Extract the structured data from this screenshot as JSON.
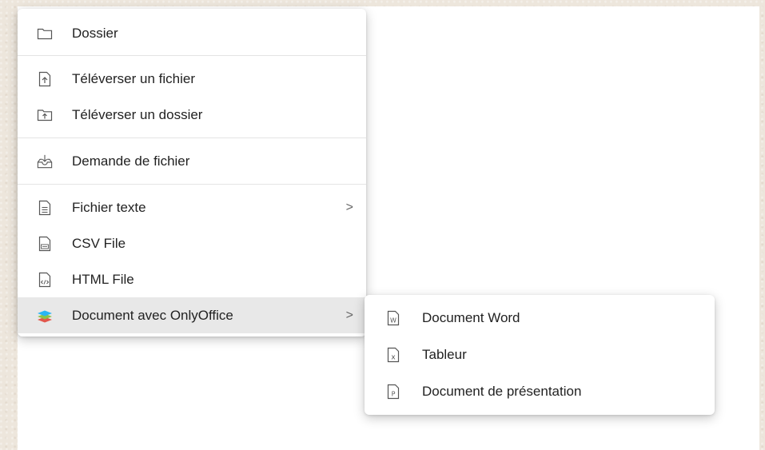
{
  "main_menu": {
    "items": [
      {
        "label": "Dossier",
        "icon": "folder-icon"
      },
      {
        "label": "Téléverser un fichier",
        "icon": "upload-file-icon"
      },
      {
        "label": "Téléverser un dossier",
        "icon": "upload-folder-icon"
      },
      {
        "label": "Demande de fichier",
        "icon": "file-request-icon"
      },
      {
        "label": "Fichier texte",
        "icon": "text-file-icon",
        "chevron": ">"
      },
      {
        "label": "CSV File",
        "icon": "csv-file-icon"
      },
      {
        "label": "HTML File",
        "icon": "html-file-icon"
      },
      {
        "label": "Document avec OnlyOffice",
        "icon": "onlyoffice-icon",
        "chevron": ">"
      }
    ]
  },
  "sub_menu": {
    "items": [
      {
        "label": "Document Word",
        "icon": "word-document-icon"
      },
      {
        "label": "Tableur",
        "icon": "spreadsheet-icon"
      },
      {
        "label": "Document de présentation",
        "icon": "presentation-icon"
      }
    ]
  },
  "colors": {
    "background": "#ede6dc",
    "menu": "#ffffff",
    "active_row": "#e8e8e8",
    "icon_gray": "#555555"
  }
}
